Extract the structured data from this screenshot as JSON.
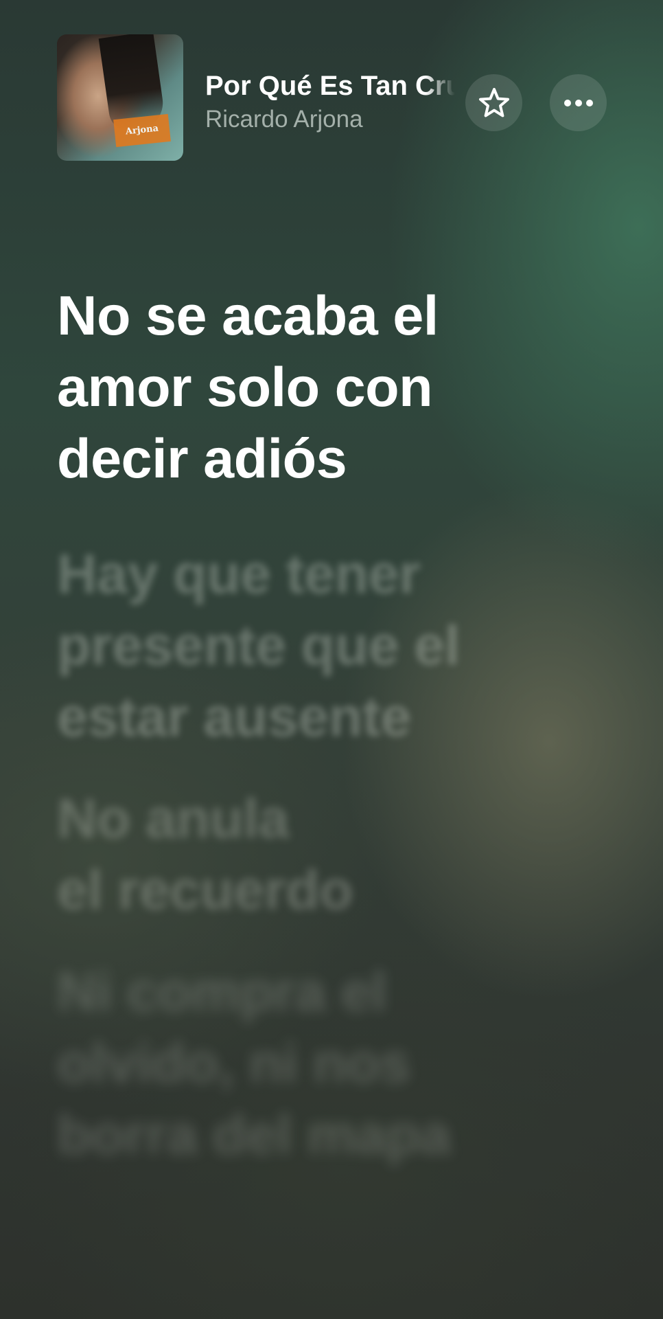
{
  "now_playing": {
    "title": "Por Qué Es Tan Cruel el Amor",
    "artist": "Ricardo Arjona",
    "album_art_label": "Arjona"
  },
  "actions": {
    "favorite_icon": "star-icon",
    "more_icon": "ellipsis-icon"
  },
  "lyrics": {
    "active": "No se acaba el\namor solo con\ndecir adiós",
    "next_lines": [
      "Hay que tener\npresente que el\nestar ausente",
      "No anula\nel recuerdo",
      "Ni compra el\nolvido, ni nos\nborra del mapa"
    ]
  },
  "colors": {
    "background_top": "#2a3934",
    "background_accent": "#40765c",
    "text_active": "#ffffff"
  }
}
